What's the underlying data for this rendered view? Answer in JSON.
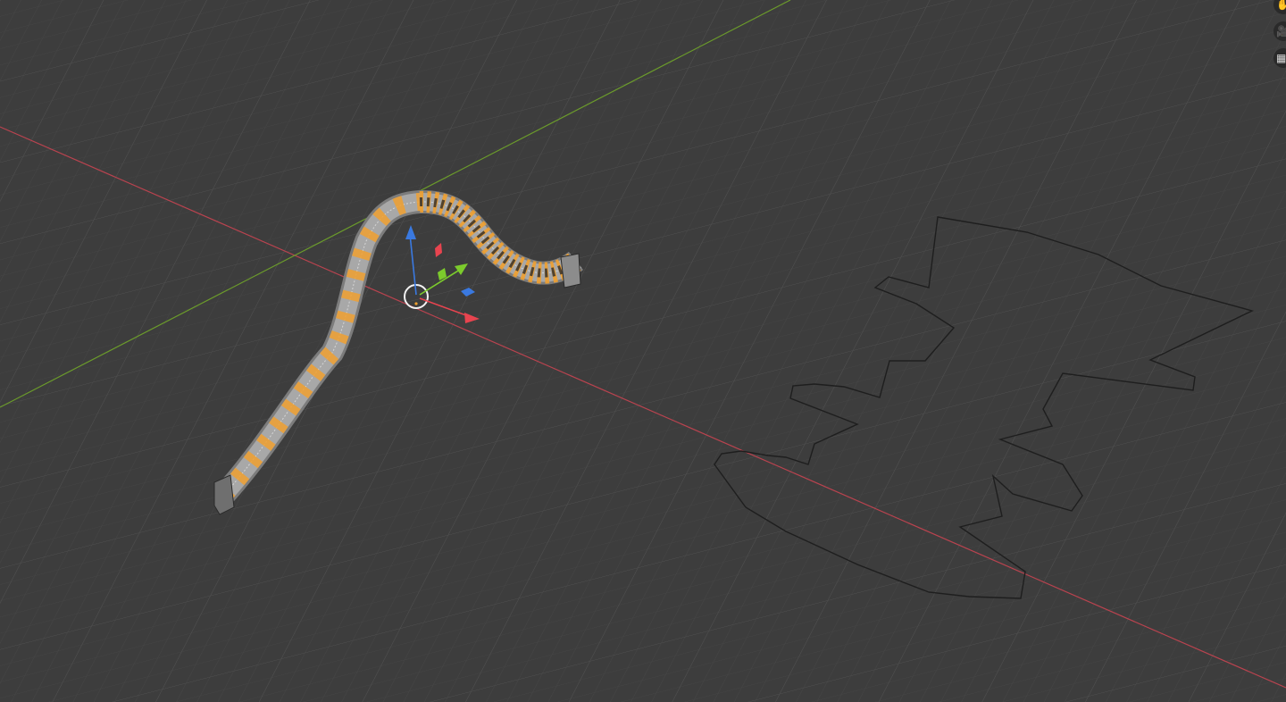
{
  "app": {
    "view": "3D Viewport"
  },
  "colors": {
    "background": "#3d3d3d",
    "grid_minor": "#454545",
    "grid_major": "#4e4e4e",
    "axis_x": "#b9434f",
    "axis_y": "#6b9b2b",
    "selection": "#f0a030",
    "wire_dark": "#1e1e1e",
    "gizmo_x": "#e8444f",
    "gizmo_y": "#7ccb2c",
    "gizmo_z": "#3a79e0"
  },
  "navigation": {
    "pan_icon": "hand-icon",
    "camera_icon": "camera-icon",
    "perspective_icon": "grid-icon"
  }
}
